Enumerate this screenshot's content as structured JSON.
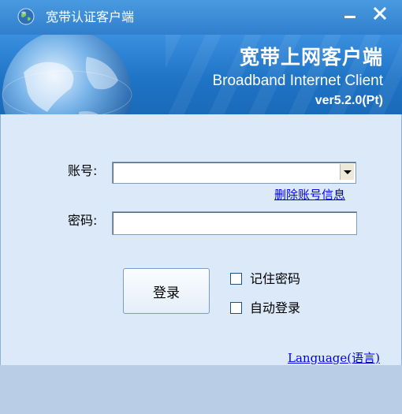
{
  "window": {
    "title": "宽带认证客户端",
    "minimize_symbol": "—",
    "close_symbol": "×"
  },
  "banner": {
    "title_cn": "宽带上网客户端",
    "title_en": "Broadband Internet Client",
    "version": "ver5.2.0(Pt)"
  },
  "form": {
    "account_label": "账号:",
    "account_value": "",
    "delete_account_link": "删除账号信息",
    "password_label": "密码:",
    "password_value": "",
    "login_button": "登录",
    "remember_password_label": "记住密码",
    "remember_password_checked": false,
    "auto_login_label": "自动登录",
    "auto_login_checked": false
  },
  "footer": {
    "language_link": "Language(语言)"
  },
  "colors": {
    "title_bar": "#3a8ad6",
    "banner": "#2a7cd0",
    "content_bg": "#dbe9f8",
    "link": "#0000ee"
  }
}
